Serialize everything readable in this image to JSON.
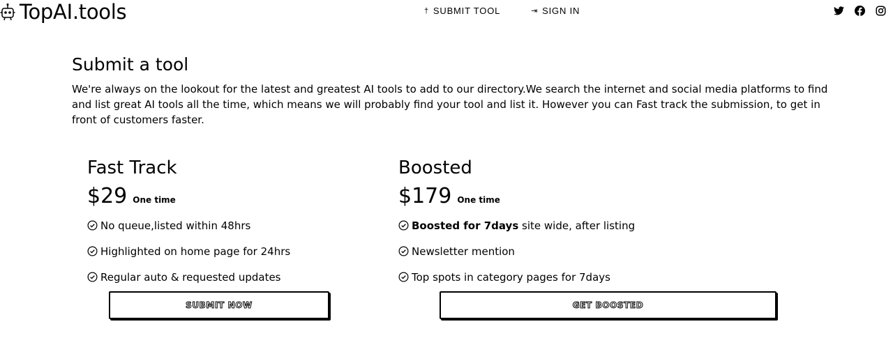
{
  "header": {
    "logo_text": "TopAI.tools",
    "logo_icon": "robot-icon",
    "nav": [
      {
        "label": "SUBMIT TOOL",
        "icon": "pin-icon",
        "glyph": "†"
      },
      {
        "label": "SIGN IN",
        "icon": "sign-in-icon",
        "glyph": "⇥"
      }
    ],
    "social": [
      "twitter-icon",
      "facebook-icon",
      "instagram-icon"
    ]
  },
  "intro": {
    "title": "Submit a tool",
    "body": "We're always on the lookout for the latest and greatest AI tools to add to our directory.We search the internet and social media platforms to find and list great AI tools all the time, which means we will probably find your tool and list it. However you can Fast track the submission, to get in front of customers faster."
  },
  "plans": [
    {
      "name": "Fast Track",
      "price": "$29",
      "period": "One time",
      "features": [
        {
          "bold": "",
          "text": "No queue,listed within 48hrs"
        },
        {
          "bold": "",
          "text": "Highlighted on home page for 24hrs"
        },
        {
          "bold": "",
          "text": "Regular auto & requested updates"
        }
      ],
      "button": "SUBMIT NOW"
    },
    {
      "name": "Boosted",
      "price": "$179",
      "period": "One time",
      "features": [
        {
          "bold": "Boosted for 7days",
          "text": " site wide, after listing"
        },
        {
          "bold": "",
          "text": "Newsletter mention"
        },
        {
          "bold": "",
          "text": "Top spots in category pages for 7days"
        }
      ],
      "button": "GET BOOSTED"
    }
  ],
  "colors": {
    "text": "#000000",
    "background": "#ffffff"
  }
}
